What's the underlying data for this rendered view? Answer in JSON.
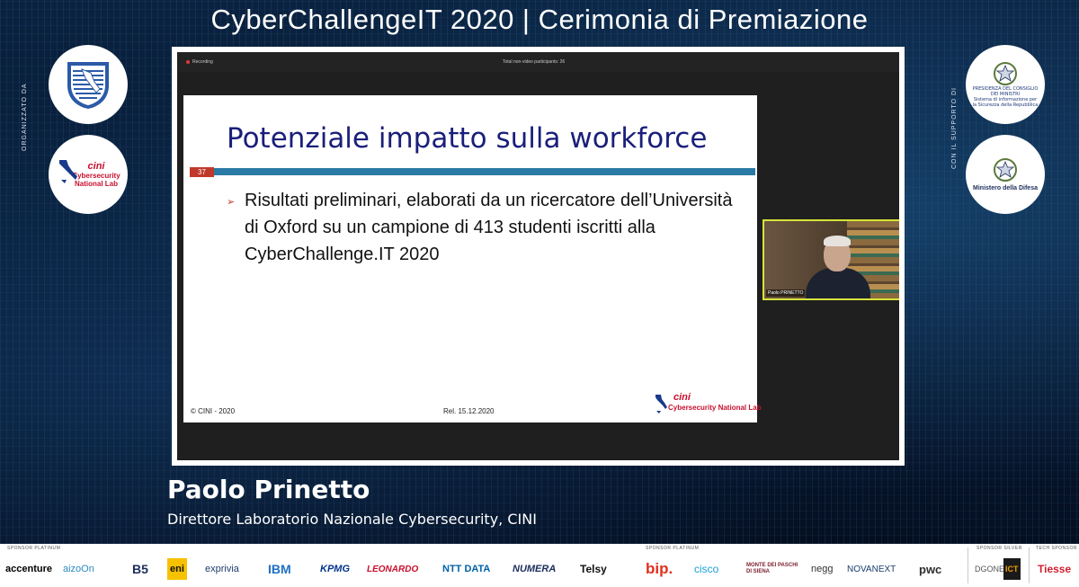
{
  "event": {
    "title": "CyberChallengeIT 2020 | Cerimonia di Premiazione",
    "organized_by": "ORGANIZZATO DA",
    "supported_by": "CON IL SUPPORTO DI"
  },
  "organizers": {
    "logo2_top": "cini",
    "logo2_bottom": "Cybersecurity National Lab"
  },
  "supporters": {
    "gov_line1": "PRESIDENZA DEL CONSIGLIO DEI MINISTRI",
    "gov_line2": "Sistema di informazione per la Sicurezza della Repubblica",
    "difesa": "Ministero della Difesa"
  },
  "meeting": {
    "recording_label": "Recording",
    "participants_label": "Total non-video participants: 26",
    "speaker_tile_name": "Paolo PRINETTO"
  },
  "slide": {
    "title": "Potenziale impatto sulla workforce",
    "number": "37",
    "bullet": "Risultati preliminari, elaborati da un ricercatore dell’Università di Oxford su un campione di 413 studenti iscritti alla CyberChallenge.IT 2020",
    "footer_left": "© CINI - 2020",
    "footer_center": "Rel. 15.12.2020",
    "logo_top": "cini",
    "logo_bottom": "Cybersecurity National Lab"
  },
  "speaker": {
    "name": "Paolo Prinetto",
    "role": "Direttore Laboratorio Nazionale Cybersecurity, CINI"
  },
  "sponsors": {
    "platinum_label_1": "SPONSOR PLATINUM",
    "platinum_label_2": "SPONSOR PLATINUM",
    "silver_label": "SPONSOR SILVER",
    "tech_label": "TECH SPONSOR",
    "logos": [
      "accenture",
      "aizoOn",
      "B5",
      "eni",
      "exprivia",
      "IBM",
      "KPMG",
      "LEONARDO",
      "NTT DATA",
      "NUMERA",
      "Telsy",
      "bip.",
      "cisco",
      "MONTE DEI PASCHI DI SIENA",
      "negg",
      "NOVANEXT",
      "pwc",
      "DGONE",
      "ICT",
      "Tiesse"
    ]
  },
  "colors": {
    "slide_title": "#1a1f7a",
    "slide_rule": "#2a7aa6",
    "accent_red": "#c0392b",
    "tile_border": "#d7e33a"
  }
}
